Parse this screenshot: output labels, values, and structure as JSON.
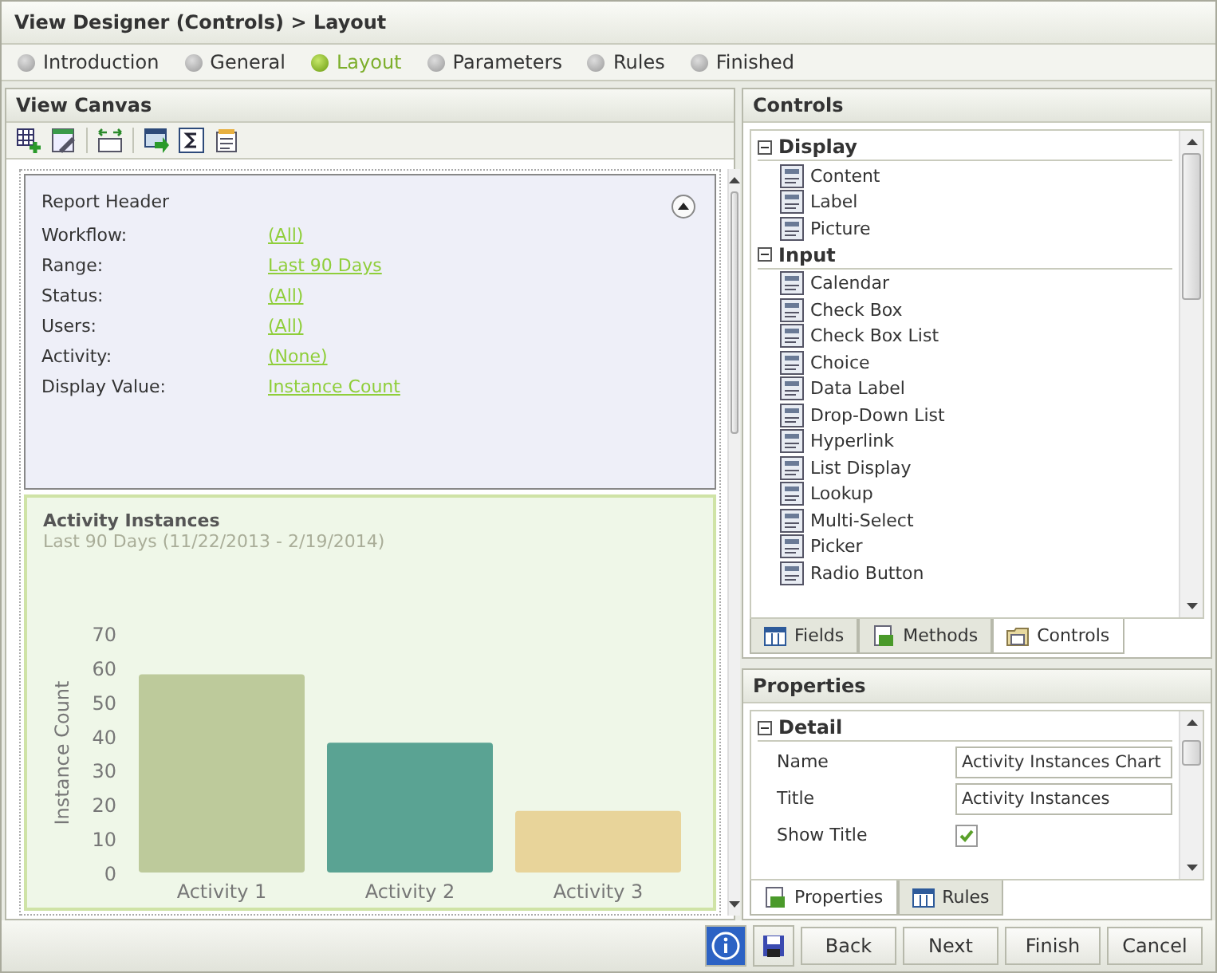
{
  "window": {
    "title": "View Designer (Controls) > Layout"
  },
  "steps": [
    {
      "label": "Introduction",
      "selected": false
    },
    {
      "label": "General",
      "selected": false
    },
    {
      "label": "Layout",
      "selected": true
    },
    {
      "label": "Parameters",
      "selected": false
    },
    {
      "label": "Rules",
      "selected": false
    },
    {
      "label": "Finished",
      "selected": false
    }
  ],
  "canvas": {
    "title": "View Canvas",
    "report_header": {
      "title": "Report Header",
      "expanded": true,
      "fields": [
        {
          "label": "Workflow:",
          "value": "(All)"
        },
        {
          "label": "Range:",
          "value": "Last 90 Days"
        },
        {
          "label": "Status:",
          "value": "(All)"
        },
        {
          "label": "Users:",
          "value": "(All)"
        },
        {
          "label": "Activity:",
          "value": "(None)"
        },
        {
          "label": "Display Value:",
          "value": "Instance Count"
        }
      ]
    },
    "chart_panel": {
      "title": "Activity Instances",
      "subtitle": "Last 90 Days (11/22/2013 - 2/19/2014)",
      "chart_data": {
        "type": "bar",
        "ylabel": "Instance Count",
        "categories": [
          "Activity 1",
          "Activity 2",
          "Activity 3"
        ],
        "series": [
          {
            "values": [
              58,
              38,
              18
            ]
          }
        ],
        "colors": [
          "#bdca9b",
          "#5aa393",
          "#e8d49a"
        ],
        "ylim": [
          0,
          70
        ],
        "yticks": [
          0,
          10,
          20,
          30,
          40,
          50,
          60,
          70
        ]
      }
    }
  },
  "controls": {
    "title": "Controls",
    "groups": [
      {
        "label": "Display",
        "expanded": true,
        "items": [
          "Content",
          "Label",
          "Picture"
        ]
      },
      {
        "label": "Input",
        "expanded": true,
        "items": [
          "Calendar",
          "Check Box",
          "Check Box List",
          "Choice",
          "Data Label",
          "Drop-Down List",
          "Hyperlink",
          "List Display",
          "Lookup",
          "Multi-Select",
          "Picker",
          "Radio Button"
        ]
      }
    ],
    "tabs": [
      {
        "label": "Fields",
        "selected": false
      },
      {
        "label": "Methods",
        "selected": false
      },
      {
        "label": "Controls",
        "selected": true
      }
    ]
  },
  "properties": {
    "title": "Properties",
    "group": {
      "label": "Detail",
      "expanded": true
    },
    "rows": [
      {
        "kind": "text",
        "label": "Name",
        "value": "Activity Instances Chart"
      },
      {
        "kind": "text",
        "label": "Title",
        "value": "Activity Instances"
      },
      {
        "kind": "checkbox",
        "label": "Show Title",
        "checked": true
      }
    ],
    "tabs": [
      {
        "label": "Properties",
        "selected": true
      },
      {
        "label": "Rules",
        "selected": false
      }
    ]
  },
  "buttons": [
    "Back",
    "Next",
    "Finish",
    "Cancel"
  ]
}
